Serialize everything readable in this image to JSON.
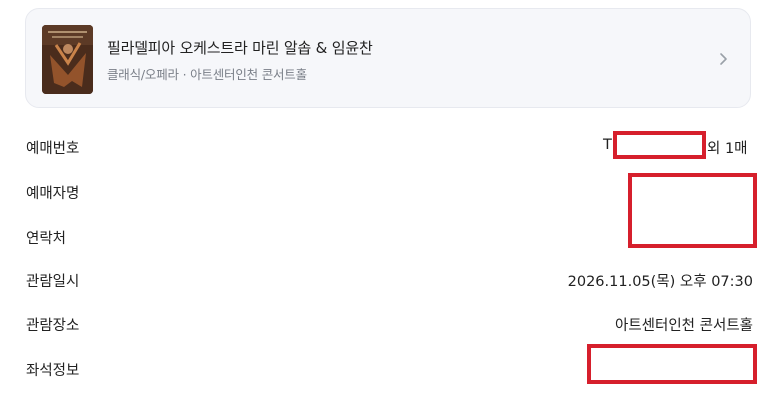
{
  "event": {
    "title": "필라델피아 오케스트라 마린 알솝 & 임윤찬",
    "meta": "클래식/오페라 · 아트센터인천 콘서트홀"
  },
  "details": {
    "reservation_number": {
      "label": "예매번호",
      "prefix": "T",
      "suffix": "외 1매"
    },
    "booker_name": {
      "label": "예매자명"
    },
    "contact": {
      "label": "연락처"
    },
    "viewing_datetime": {
      "label": "관람일시",
      "value": "2026.11.05(목) 오후 07:30"
    },
    "venue": {
      "label": "관람장소",
      "value": "아트센터인천 콘서트홀"
    },
    "seat_info": {
      "label": "좌석정보"
    }
  },
  "icons": {
    "chevron": "chevron-right-icon"
  },
  "colors": {
    "redaction": "#d61f2c",
    "card_bg": "#f6f7fa",
    "muted_text": "#7a7f88"
  }
}
